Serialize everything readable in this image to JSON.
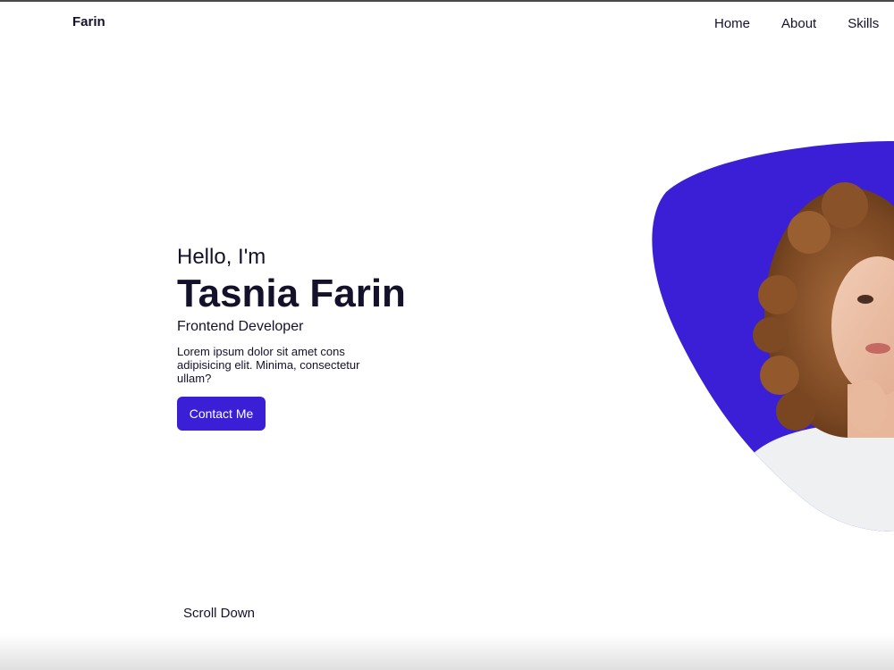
{
  "header": {
    "brand": "Farin",
    "nav": [
      {
        "label": "Home"
      },
      {
        "label": "About"
      },
      {
        "label": "Skills"
      }
    ]
  },
  "hero": {
    "greeting": "Hello, I'm",
    "name": "Tasnia Farin",
    "role": "Frontend Developer",
    "description": "Lorem ipsum dolor sit amet cons adipisicing elit. Minima, consectetur ullam?",
    "cta_label": "Contact Me"
  },
  "scroll": {
    "label": "Scroll Down"
  },
  "colors": {
    "accent": "#3a1fd6",
    "text": "#14112b",
    "background": "#ffffff"
  }
}
